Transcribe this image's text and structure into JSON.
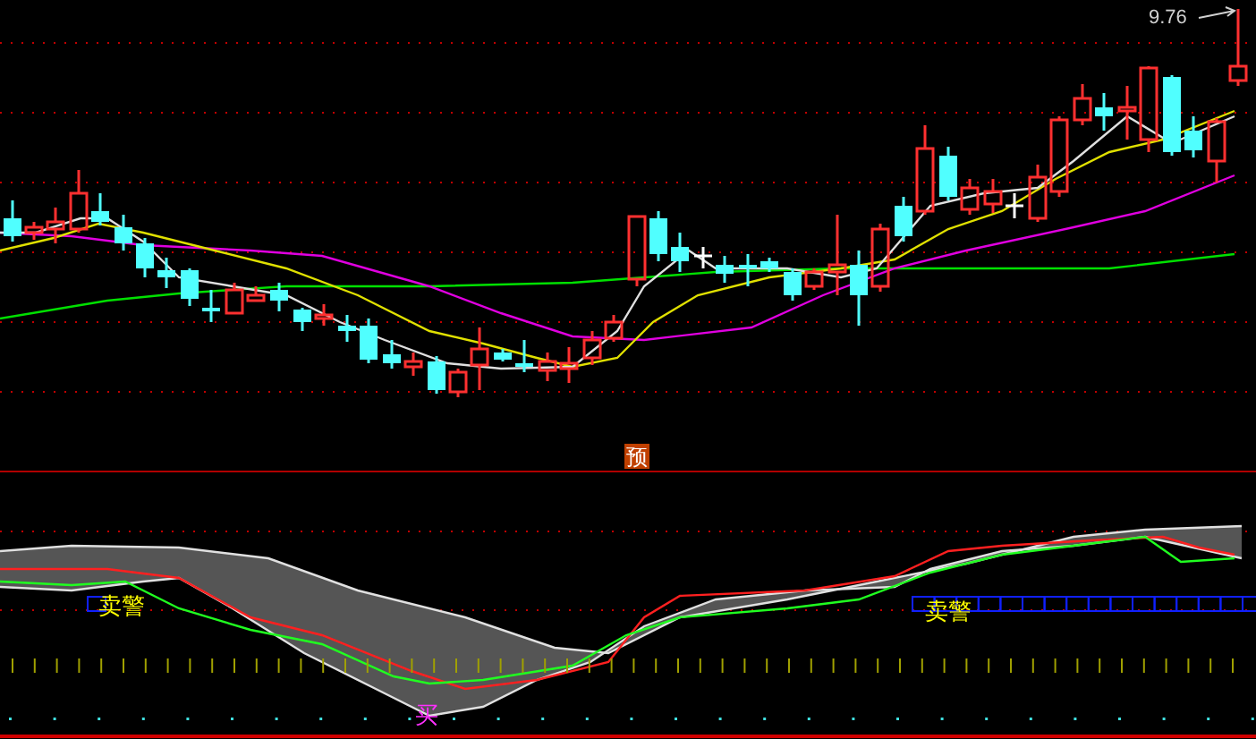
{
  "price_panel": {
    "high_label": "9.76",
    "signal_badge": "预"
  },
  "indicator_panel": {
    "sell_alerts": [
      {
        "label": "卖警"
      },
      {
        "label": "卖警"
      }
    ],
    "buy_alerts": [
      {
        "label": "买"
      }
    ]
  }
}
